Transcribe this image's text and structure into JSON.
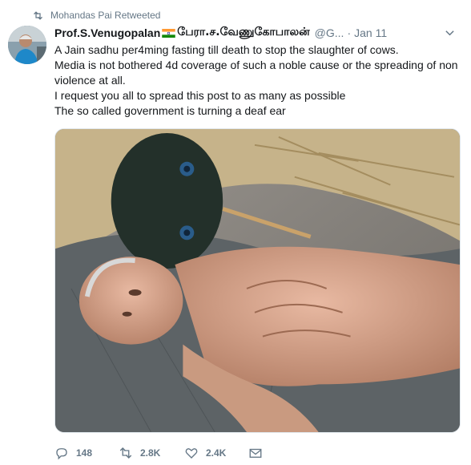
{
  "retweet_context": {
    "icon": "retweet-icon",
    "text": "Mohandas Pai Retweeted"
  },
  "tweet": {
    "display_name": "Prof.S.Venugopalan",
    "flag_icon": "india-flag-icon",
    "tamil_name": "பேரா.ச.வேணுகோபாலன்",
    "handle": "@G...",
    "separator": "·",
    "timestamp": "Jan 11",
    "text_lines": [
      "A Jain sadhu per4ming fasting till death to stop the slaughter of cows.",
      "Media is not bothered 4d coverage of such a noble cause or the spreading of non violence at all.",
      "I request you all to spread this post to as many as possible",
      "The so called government is turning a deaf ear"
    ],
    "media": {
      "type": "photo"
    }
  },
  "actions": {
    "reply": {
      "icon": "reply-icon",
      "count": "148"
    },
    "retweet": {
      "icon": "retweet-icon",
      "count": "2.8K"
    },
    "like": {
      "icon": "heart-icon",
      "count": "2.4K"
    },
    "dm": {
      "icon": "envelope-icon"
    }
  },
  "colors": {
    "text_primary": "#14171a",
    "text_secondary": "#657786",
    "border": "#e1e8ed"
  }
}
